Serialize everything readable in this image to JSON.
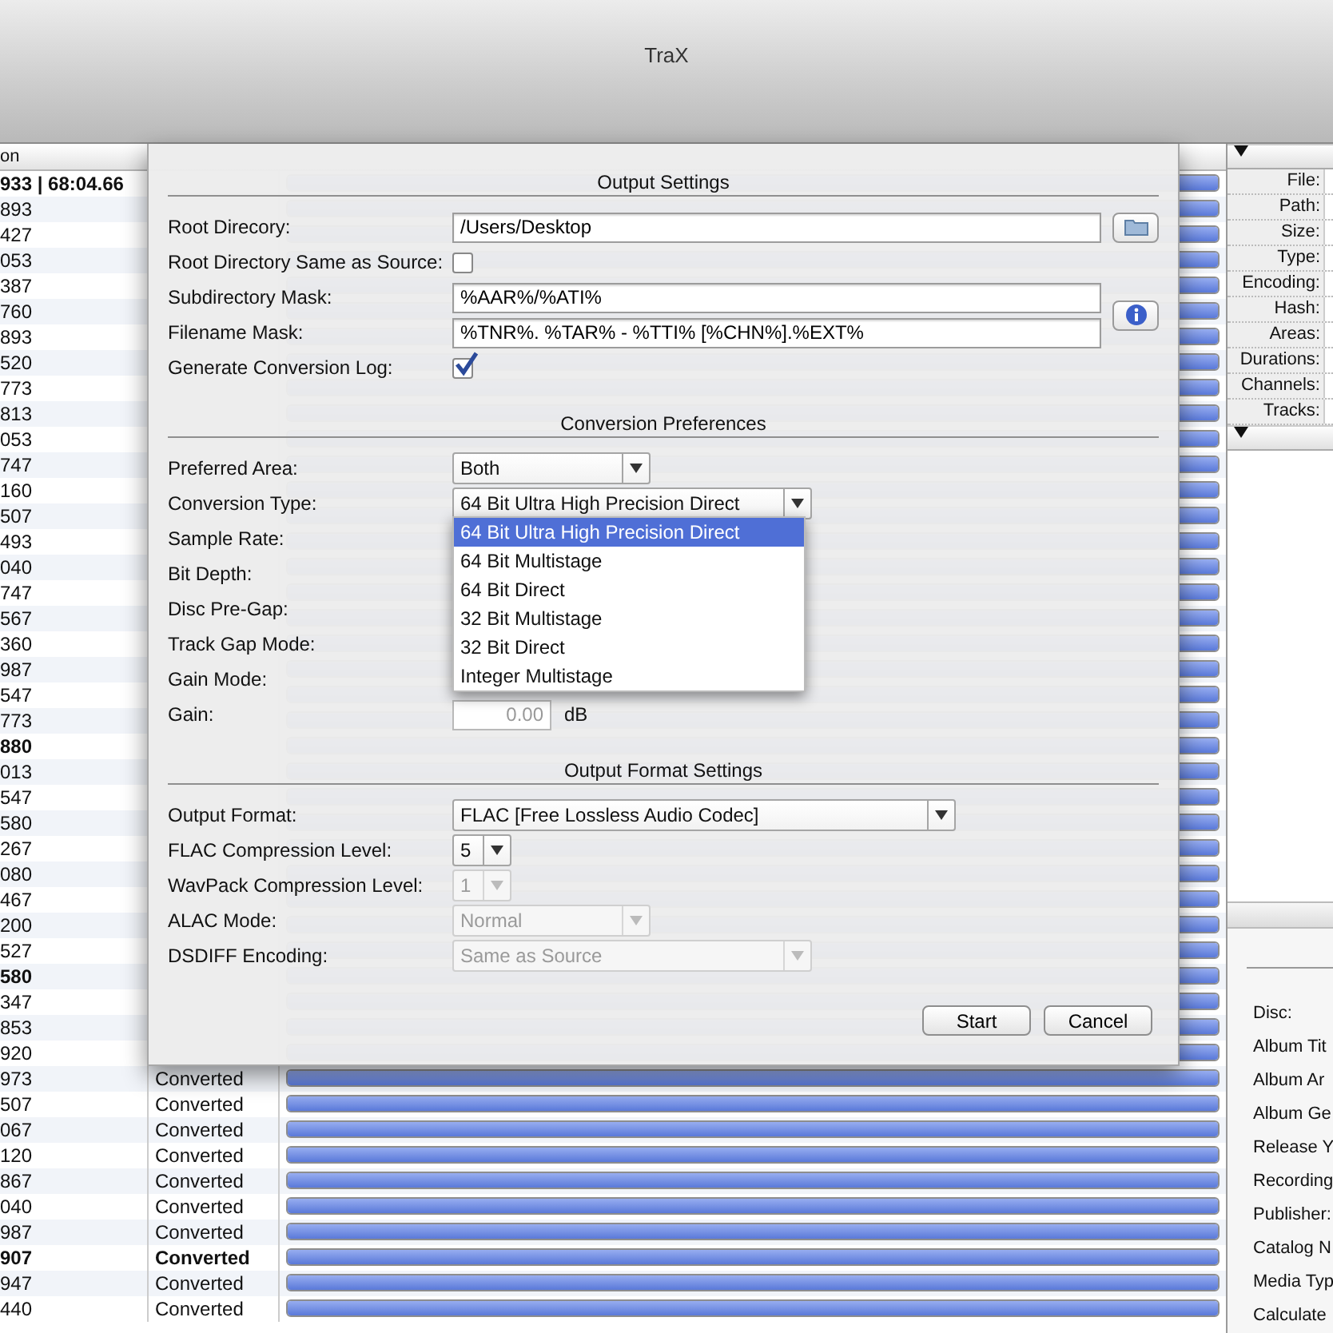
{
  "window": {
    "title": "TraX"
  },
  "table": {
    "columns": [
      {
        "label": "on"
      }
    ],
    "rows": [
      {
        "column_1": "933 | 68:04.66",
        "bold": true,
        "level": 1
      },
      {
        "column_1": "893",
        "bold": false,
        "level": 1
      },
      {
        "column_1": "427",
        "bold": false,
        "level": 1
      },
      {
        "column_1": "053",
        "bold": false,
        "level": 1
      },
      {
        "column_1": "387",
        "bold": false,
        "level": 1
      },
      {
        "column_1": "760",
        "bold": false,
        "level": 1
      },
      {
        "column_1": "893",
        "bold": false,
        "level": 1
      },
      {
        "column_1": "520",
        "bold": false,
        "level": 1
      },
      {
        "column_1": "773",
        "bold": false,
        "level": 1
      },
      {
        "column_1": "813",
        "bold": false,
        "level": 1
      },
      {
        "column_1": "053",
        "bold": false,
        "level": 1
      },
      {
        "column_1": "747",
        "bold": false,
        "level": 1
      },
      {
        "column_1": "160",
        "bold": false,
        "level": 1
      },
      {
        "column_1": "507",
        "bold": false,
        "level": 1
      },
      {
        "column_1": "493",
        "bold": false,
        "level": 1
      },
      {
        "column_1": "040",
        "bold": false,
        "level": 1
      },
      {
        "column_1": "747",
        "bold": false,
        "level": 1
      },
      {
        "column_1": "567",
        "bold": false,
        "level": 1
      },
      {
        "column_1": "360",
        "bold": false,
        "level": 1
      },
      {
        "column_1": "987",
        "bold": false,
        "level": 1
      },
      {
        "column_1": "547",
        "bold": false,
        "level": 1
      },
      {
        "column_1": "773",
        "bold": false,
        "level": 1
      },
      {
        "column_1": "880",
        "bold": true,
        "level": 1
      },
      {
        "column_1": "013",
        "bold": false,
        "level": 1
      },
      {
        "column_1": "547",
        "bold": false,
        "level": 1
      },
      {
        "column_1": "580",
        "bold": false,
        "level": 1
      },
      {
        "column_1": "267",
        "bold": false,
        "level": 1
      },
      {
        "column_1": "080",
        "bold": false,
        "level": 1
      },
      {
        "column_1": "467",
        "bold": false,
        "level": 1
      },
      {
        "column_1": "200",
        "bold": false,
        "level": 1
      },
      {
        "column_1": "527",
        "bold": false,
        "level": 1
      },
      {
        "column_1": "580",
        "bold": true,
        "level": 1
      },
      {
        "column_1": "347",
        "bold": false,
        "level": 1
      },
      {
        "column_1": "853",
        "bold": false,
        "level": 1
      },
      {
        "column_1": "920",
        "bold": false,
        "level": 1
      },
      {
        "column_1": "973",
        "status": "Converted",
        "bold": false,
        "level": 1
      },
      {
        "column_1": "507",
        "status": "Converted",
        "bold": false,
        "level": 1
      },
      {
        "column_1": "067",
        "status": "Converted",
        "bold": false,
        "level": 1
      },
      {
        "column_1": "120",
        "status": "Converted",
        "bold": false,
        "level": 1
      },
      {
        "column_1": "867",
        "status": "Converted",
        "bold": false,
        "level": 1
      },
      {
        "column_1": "040",
        "status": "Converted",
        "bold": false,
        "level": 1
      },
      {
        "column_1": "987",
        "status": "Converted",
        "bold": false,
        "level": 1
      },
      {
        "column_1": "907",
        "status": "Converted",
        "bold": true,
        "level": 1
      },
      {
        "column_1": "947",
        "status": "Converted",
        "bold": false,
        "level": 1
      },
      {
        "column_1": "440",
        "status": "Converted",
        "bold": false,
        "level": 1
      }
    ]
  },
  "file_info": {
    "fields": [
      "File:",
      "Path:",
      "Size:",
      "Type:",
      "Encoding:",
      "Hash:",
      "Areas:",
      "Durations:",
      "Channels:",
      "Tracks:"
    ]
  },
  "tags": {
    "fields": [
      "Disc:",
      "Album Tit",
      "Album Ar",
      "Album Ge",
      "Release Y",
      "Recording",
      "Publisher:",
      "Catalog N",
      "Media Typ",
      "Calculate"
    ]
  },
  "sheet": {
    "sections": [
      {
        "title": "Output Settings",
        "rows": [
          {
            "label": "Root Direcory:",
            "kind": "text",
            "value": "/Users/Desktop",
            "accessory": {
              "kind": "folder"
            }
          },
          {
            "label": "Root Directory Same as Source:",
            "kind": "checkbox",
            "checked": false
          },
          {
            "label": "Subdirectory Mask:",
            "kind": "text",
            "value": "%AAR%/%ATI%",
            "accessory": {
              "kind": "info"
            }
          },
          {
            "label": "Filename Mask:",
            "kind": "text",
            "value": "%TNR%. %TAR% - %TTI% [%CHN%].%EXT%"
          },
          {
            "label": "Generate Conversion Log:",
            "kind": "checkbox",
            "checked": true
          }
        ]
      },
      {
        "title": "Conversion Preferences",
        "rows": [
          {
            "label": "Preferred Area:",
            "kind": "select",
            "value": "Both",
            "disabled": false
          },
          {
            "label": "Conversion Type:",
            "kind": "select",
            "value": "64 Bit Ultra High Precision Direct",
            "disabled": false,
            "open": true,
            "options": [
              {
                "label": "64 Bit Ultra High Precision Direct",
                "selected": true
              },
              {
                "label": "64 Bit Multistage",
                "selected": false
              },
              {
                "label": "64 Bit Direct",
                "selected": false
              },
              {
                "label": "32 Bit Multistage",
                "selected": false
              },
              {
                "label": "32 Bit Direct",
                "selected": false
              },
              {
                "label": "Integer Multistage",
                "selected": false
              }
            ]
          },
          {
            "label": "Sample Rate:",
            "kind": "none"
          },
          {
            "label": "Bit Depth:",
            "kind": "none"
          },
          {
            "label": "Disc Pre-Gap:",
            "kind": "none"
          },
          {
            "label": "Track Gap Mode:",
            "kind": "none"
          },
          {
            "label": "Gain Mode:",
            "kind": "none"
          },
          {
            "label": "Gain:",
            "kind": "field_unit",
            "value": "0.00",
            "unit": "dB",
            "disabled": true
          }
        ]
      },
      {
        "title": "Output Format Settings",
        "rows": [
          {
            "label": "Output Format:",
            "kind": "select",
            "value": "FLAC [Free Lossless Audio Codec]",
            "disabled": false
          },
          {
            "label": "FLAC Compression Level:",
            "kind": "select",
            "value": "5",
            "disabled": false
          },
          {
            "label": "WavPack Compression Level:",
            "kind": "select",
            "value": "1",
            "disabled": true
          },
          {
            "label": "ALAC Mode:",
            "kind": "select",
            "value": "Normal",
            "disabled": true
          },
          {
            "label": "DSDIFF Encoding:",
            "kind": "select",
            "value": "Same as Source",
            "disabled": true
          }
        ]
      }
    ],
    "buttons": [
      "Start",
      "Cancel"
    ]
  }
}
